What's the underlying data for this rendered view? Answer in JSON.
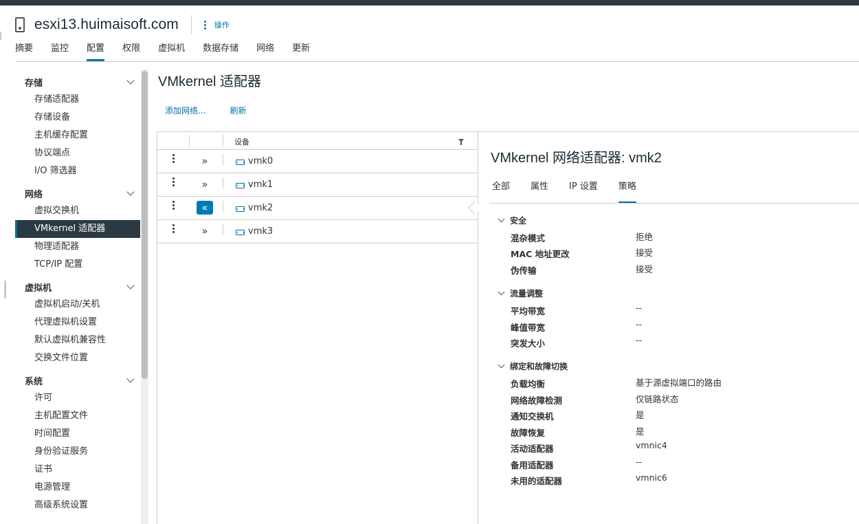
{
  "host": {
    "title": "esxi13.huimaisoft.com",
    "actions_label": "操作"
  },
  "main_tabs": [
    "摘要",
    "监控",
    "配置",
    "权限",
    "虚拟机",
    "数据存储",
    "网络",
    "更新"
  ],
  "nav": {
    "storage": {
      "label": "存储",
      "items": [
        "存储适配器",
        "存储设备",
        "主机缓存配置",
        "协议端点",
        "I/O 筛选器"
      ]
    },
    "network": {
      "label": "网络",
      "items": [
        "虚拟交换机",
        "VMkernel 适配器",
        "物理适配器",
        "TCP/IP 配置"
      ]
    },
    "vm": {
      "label": "虚拟机",
      "items": [
        "虚拟机启动/关机",
        "代理虚拟机设置",
        "默认虚拟机兼容性",
        "交换文件位置"
      ]
    },
    "system": {
      "label": "系统",
      "items": [
        "许可",
        "主机配置文件",
        "时间配置",
        "身份验证服务",
        "证书",
        "电源管理",
        "高级系统设置"
      ]
    }
  },
  "page": {
    "title": "VMkernel 适配器",
    "add_network": "添加网络...",
    "refresh": "刷新"
  },
  "grid": {
    "column_device": "设备",
    "rows": [
      "vmk0",
      "vmk1",
      "vmk2",
      "vmk3"
    ]
  },
  "detail": {
    "title": "VMkernel 网络适配器: vmk2",
    "tabs": [
      "全部",
      "属性",
      "IP 设置",
      "策略"
    ],
    "security": {
      "label": "安全",
      "props": [
        {
          "label": "混杂模式",
          "value": "拒绝"
        },
        {
          "label": "MAC 地址更改",
          "value": "接受"
        },
        {
          "label": "伪传输",
          "value": "接受"
        }
      ]
    },
    "traffic": {
      "label": "流量调整",
      "props": [
        {
          "label": "平均带宽",
          "value": "--"
        },
        {
          "label": "峰值带宽",
          "value": "--"
        },
        {
          "label": "突发大小",
          "value": "--"
        }
      ]
    },
    "teaming": {
      "label": "绑定和故障切换",
      "props": [
        {
          "label": "负载均衡",
          "value": "基于源虚拟端口的路由"
        },
        {
          "label": "网络故障检测",
          "value": "仅链路状态"
        },
        {
          "label": "通知交换机",
          "value": "是"
        },
        {
          "label": "故障恢复",
          "value": "是"
        },
        {
          "label": "活动适配器",
          "value": "vmnic4"
        },
        {
          "label": "备用适配器",
          "value": "--"
        },
        {
          "label": "未用的适配器",
          "value": "vmnic6"
        }
      ]
    }
  }
}
